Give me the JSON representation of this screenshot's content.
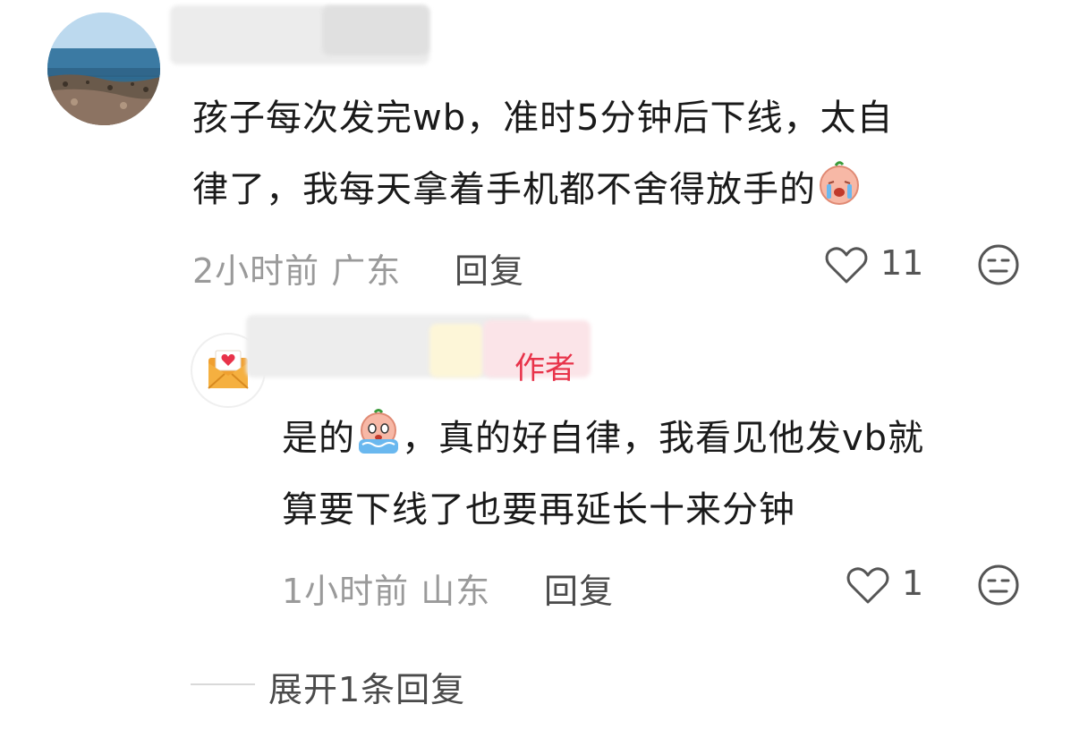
{
  "comments": [
    {
      "text_line1": "孩子每次发完wb，准时5分钟后下线，太自",
      "text_line2": "律了，我每天拿着手机都不舍得放手的",
      "time": "2小时前",
      "location": "广东",
      "reply_label": "回复",
      "like_count": "11",
      "emoji_icon": "crying-face-emoji-icon"
    },
    {
      "text_line1_prefix": "是的",
      "text_line1_suffix": "，真的好自律，我看见他发vb就",
      "text_line2": "算要下线了也要再延长十来分钟",
      "time": "1小时前",
      "location": "山东",
      "reply_label": "回复",
      "like_count": "1",
      "emoji_icon": "crying-face-emoji-icon",
      "avatar_icon": "love-letter-icon",
      "author_badge_fragment": "作者"
    }
  ],
  "expand_label": "展开1条回复",
  "colors": {
    "text": "#1a1a1a",
    "meta": "#9a9a9a",
    "reply": "#4a4a4a",
    "badge": "#e8334a",
    "envelope": "#f0a030"
  }
}
